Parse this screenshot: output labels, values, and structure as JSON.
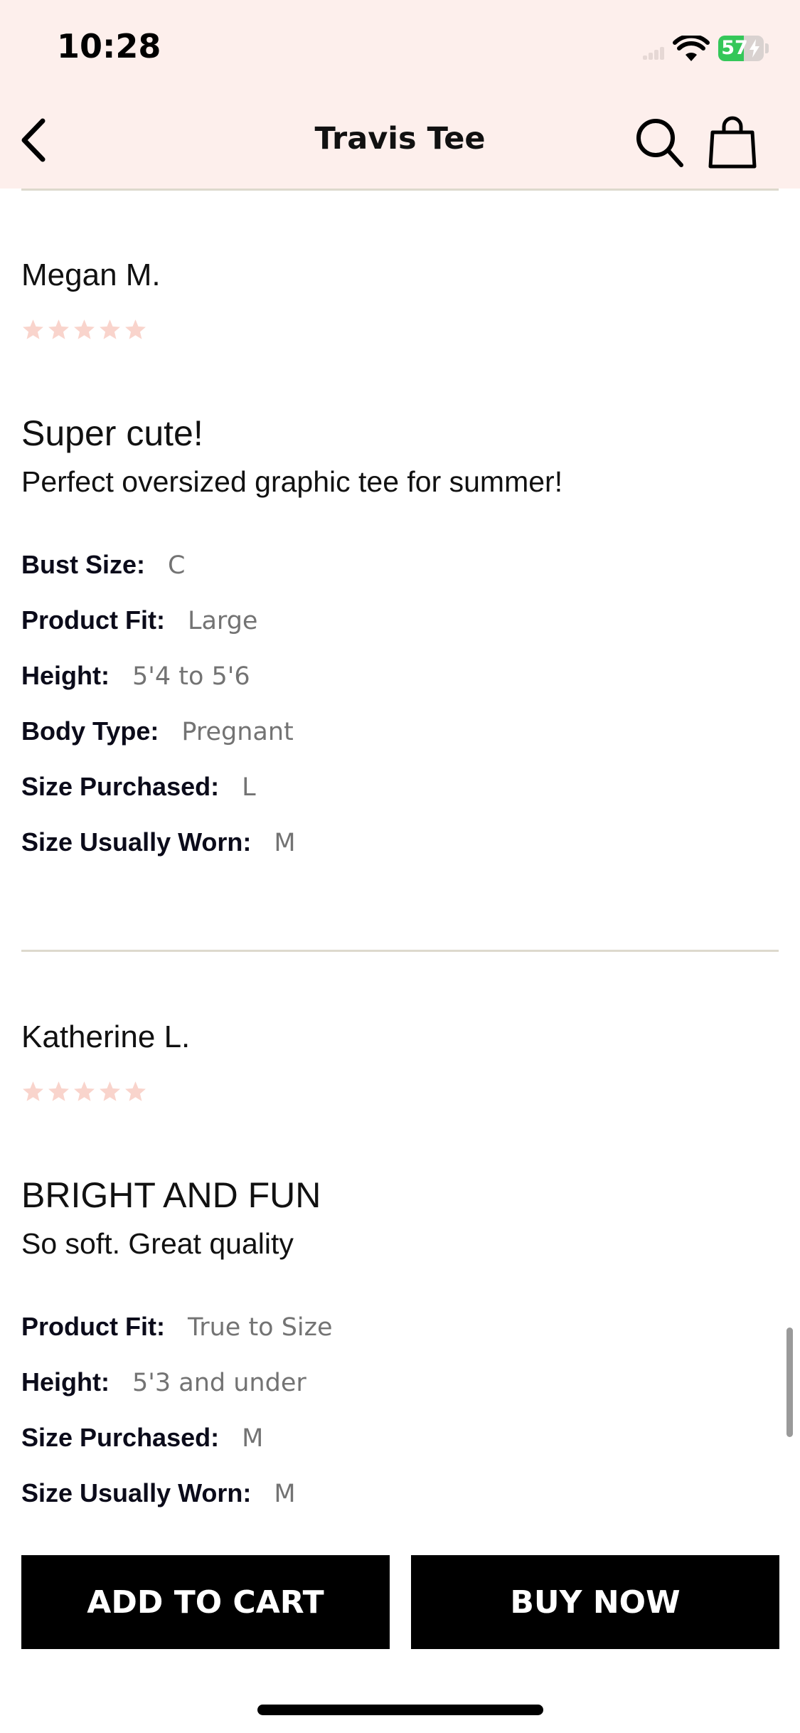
{
  "status_bar": {
    "time": "10:28",
    "battery_level": "57",
    "battery_percent_fill": 57
  },
  "nav": {
    "title": "Travis Tee",
    "back_icon": "chevron-left-icon",
    "search_icon": "search-icon",
    "bag_icon": "shopping-bag-icon"
  },
  "colors": {
    "header_bg": "#fdefec",
    "star_color": "#f9d4cc",
    "button_bg": "#000000",
    "divider": "#ddd9cd"
  },
  "reviews": [
    {
      "reviewer": "Megan M.",
      "rating": 5,
      "title": "Super cute!",
      "body": "Perfect oversized graphic tee for summer!",
      "attributes": [
        {
          "label": "Bust Size:",
          "value": "C"
        },
        {
          "label": "Product Fit:",
          "value": "Large"
        },
        {
          "label": "Height:",
          "value": "5'4 to 5'6"
        },
        {
          "label": "Body Type:",
          "value": "Pregnant"
        },
        {
          "label": "Size Purchased:",
          "value": "L"
        },
        {
          "label": "Size Usually Worn:",
          "value": "M"
        }
      ]
    },
    {
      "reviewer": "Katherine L.",
      "rating": 5,
      "title": "BRIGHT AND FUN",
      "body": "So soft. Great quality",
      "attributes": [
        {
          "label": "Product Fit:",
          "value": "True to Size"
        },
        {
          "label": "Height:",
          "value": "5'3 and under"
        },
        {
          "label": "Size Purchased:",
          "value": "M"
        },
        {
          "label": "Size Usually Worn:",
          "value": "M"
        }
      ]
    }
  ],
  "actions": {
    "add_to_cart": "ADD TO CART",
    "buy_now": "BUY NOW"
  }
}
